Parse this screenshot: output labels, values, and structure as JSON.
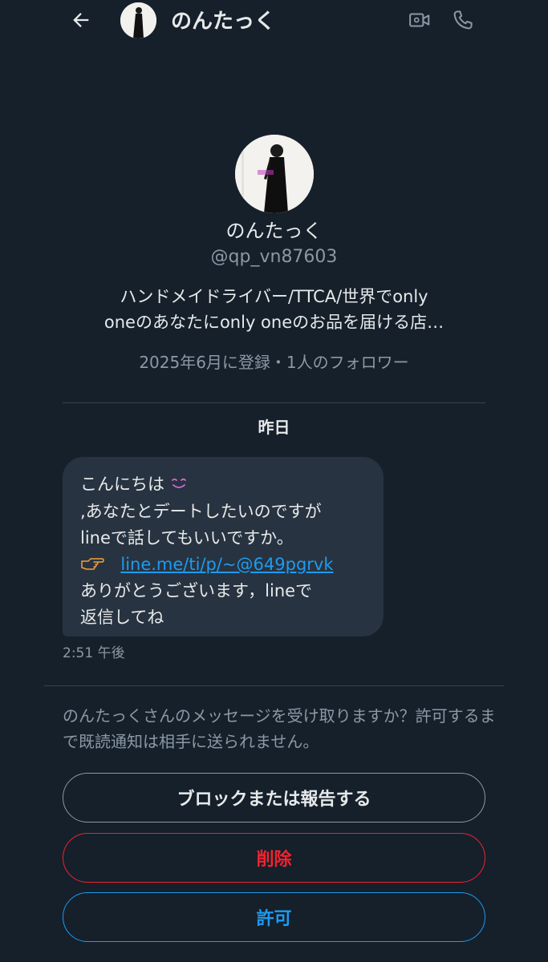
{
  "header": {
    "name": "のんたっく",
    "back_icon": "arrow-left-icon",
    "video_icon": "video-camera-icon",
    "call_icon": "phone-icon"
  },
  "profile": {
    "name": "のんたっく",
    "handle": "@qp_vn87603",
    "bio_line1": "ハンドメイドライバー/TTCA/世界でonly",
    "bio_line2": "oneのあなたにonly oneのお品を届ける店…",
    "meta": "2025年6月に登録・1人のフォロワー"
  },
  "conversation": {
    "date_separator": "昨日",
    "message": {
      "line1": "こんにちは",
      "smile_emoji": "😊",
      "line2": ",あなたとデートしたいのですが",
      "line3": "lineで話してもいいですか。",
      "pointing_emoji": "👉",
      "link": "line.me/ti/p/~@649pgrvk",
      "line5": "ありがとうございます，lineで",
      "line6": "返信してね"
    },
    "time": "2:51 午後"
  },
  "request": {
    "text": "のんたっくさんのメッセージを受け取りますか？許可するまで既読通知は相手に送られません。"
  },
  "actions": {
    "block_label": "ブロックまたは報告する",
    "delete_label": "削除",
    "accept_label": "許可"
  },
  "colors": {
    "background": "#15202b",
    "bubble": "#273340",
    "accent_blue": "#1d9bf0",
    "danger_red": "#f4212e",
    "secondary_text": "#8b98a5"
  }
}
